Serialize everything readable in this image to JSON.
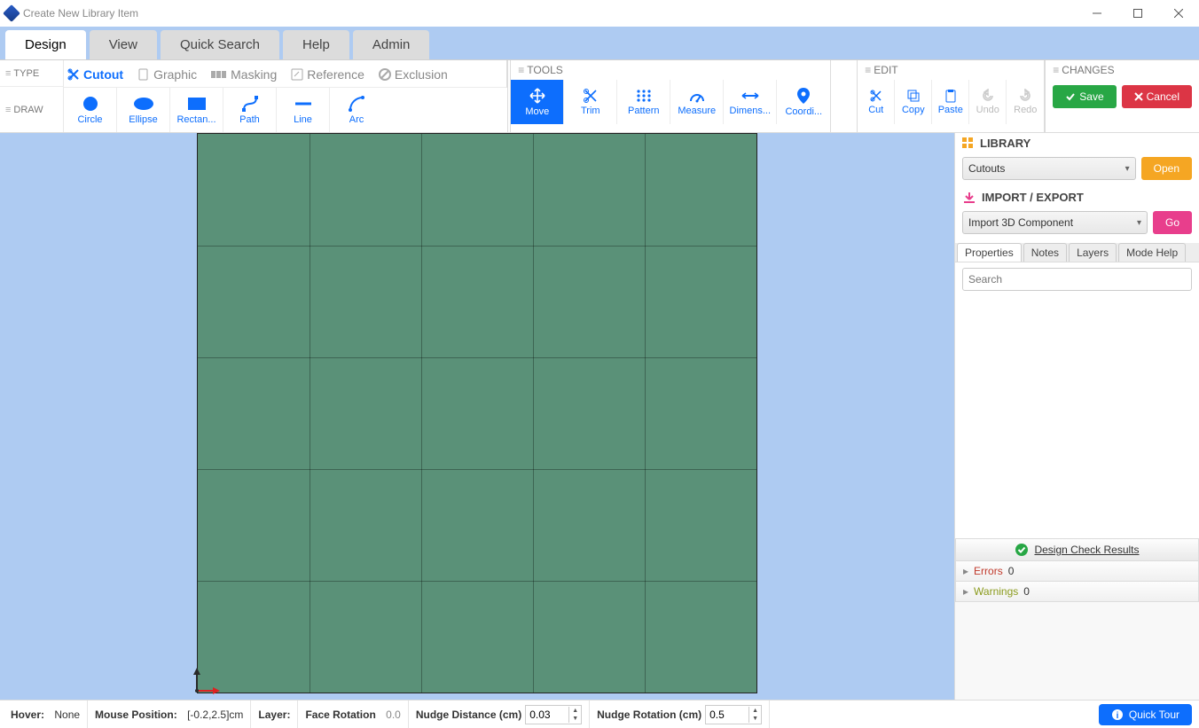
{
  "window": {
    "title": "Create New Library Item"
  },
  "mainTabs": [
    "Design",
    "View",
    "Quick Search",
    "Help",
    "Admin"
  ],
  "section": {
    "type": "TYPE",
    "draw": "DRAW"
  },
  "typeItems": [
    {
      "label": "Cutout",
      "active": true
    },
    {
      "label": "Graphic",
      "active": false
    },
    {
      "label": "Masking",
      "active": false
    },
    {
      "label": "Reference",
      "active": false
    },
    {
      "label": "Exclusion",
      "active": false
    }
  ],
  "drawTools": [
    {
      "label": "Circle"
    },
    {
      "label": "Ellipse"
    },
    {
      "label": "Rectan..."
    },
    {
      "label": "Path"
    },
    {
      "label": "Line"
    },
    {
      "label": "Arc"
    }
  ],
  "toolsGroup": {
    "header": "TOOLS",
    "items": [
      {
        "label": "Move",
        "active": true
      },
      {
        "label": "Trim"
      },
      {
        "label": "Pattern"
      },
      {
        "label": "Measure"
      },
      {
        "label": "Dimens..."
      },
      {
        "label": "Coordi..."
      }
    ]
  },
  "editGroup": {
    "header": "EDIT",
    "items": [
      {
        "label": "Cut"
      },
      {
        "label": "Copy"
      },
      {
        "label": "Paste"
      },
      {
        "label": "Undo",
        "disabled": true
      },
      {
        "label": "Redo",
        "disabled": true
      }
    ]
  },
  "changes": {
    "header": "CHANGES",
    "save": "Save",
    "cancel": "Cancel"
  },
  "library": {
    "header": "LIBRARY",
    "select": "Cutouts",
    "open": "Open"
  },
  "importExport": {
    "header": "IMPORT / EXPORT",
    "select": "Import 3D Component",
    "go": "Go"
  },
  "subTabs": [
    "Properties",
    "Notes",
    "Layers",
    "Mode Help"
  ],
  "searchPlaceholder": "Search",
  "designCheck": {
    "title": "Design Check Results",
    "errors": {
      "label": "Errors",
      "count": "0"
    },
    "warnings": {
      "label": "Warnings",
      "count": "0"
    }
  },
  "status": {
    "hoverLabel": "Hover:",
    "hoverValue": "None",
    "mouseLabel": "Mouse Position:",
    "mouseValue": "[-0.2,2.5]cm",
    "layerLabel": "Layer:",
    "faceRotLabel": "Face Rotation",
    "faceRotValue": "0.0",
    "nudgeDistLabel": "Nudge Distance (cm)",
    "nudgeDistValue": "0.03",
    "nudgeRotLabel": "Nudge Rotation (cm)",
    "nudgeRotValue": "0.5",
    "quickTour": "Quick Tour"
  }
}
